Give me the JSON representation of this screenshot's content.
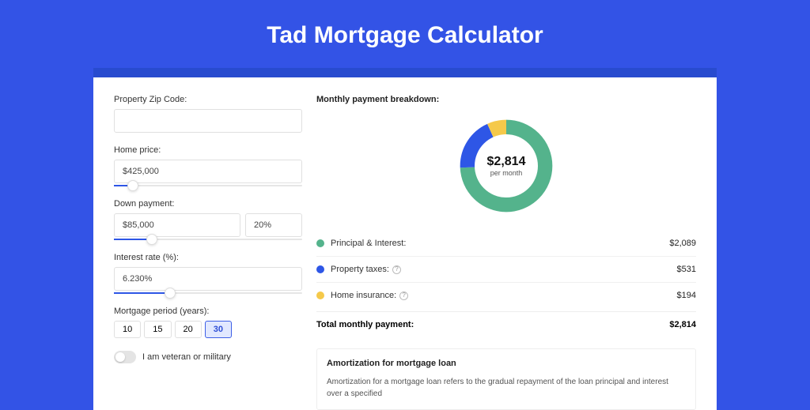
{
  "title": "Tad Mortgage Calculator",
  "form": {
    "zip": {
      "label": "Property Zip Code:",
      "value": ""
    },
    "homePrice": {
      "label": "Home price:",
      "value": "$425,000",
      "sliderPercent": 10
    },
    "downPayment": {
      "label": "Down payment:",
      "value": "$85,000",
      "percent": "20%",
      "sliderPercent": 20
    },
    "interest": {
      "label": "Interest rate (%):",
      "value": "6.230%",
      "sliderPercent": 30
    },
    "period": {
      "label": "Mortgage period (years):",
      "options": [
        "10",
        "15",
        "20",
        "30"
      ],
      "active": "30"
    },
    "veteran": {
      "label": "I am veteran or military",
      "checked": false
    }
  },
  "breakdown": {
    "heading": "Monthly payment breakdown:",
    "totalAmount": "$2,814",
    "totalSub": "per month",
    "rows": [
      {
        "label": "Principal & Interest:",
        "value": "$2,089",
        "color": "#54b38c",
        "help": false,
        "numeric": 2089
      },
      {
        "label": "Property taxes:",
        "value": "$531",
        "color": "#2e56e6",
        "help": true,
        "numeric": 531
      },
      {
        "label": "Home insurance:",
        "value": "$194",
        "color": "#f5c94a",
        "help": true,
        "numeric": 194
      }
    ],
    "totalLabel": "Total monthly payment:",
    "totalValue": "$2,814"
  },
  "chart_data": {
    "type": "pie",
    "title": "Monthly payment breakdown",
    "categories": [
      "Principal & Interest",
      "Property taxes",
      "Home insurance"
    ],
    "values": [
      2089,
      531,
      194
    ],
    "colors": [
      "#54b38c",
      "#2e56e6",
      "#f5c94a"
    ],
    "center_label": "$2,814",
    "center_sublabel": "per month"
  },
  "amort": {
    "title": "Amortization for mortgage loan",
    "text": "Amortization for a mortgage loan refers to the gradual repayment of the loan principal and interest over a specified"
  }
}
